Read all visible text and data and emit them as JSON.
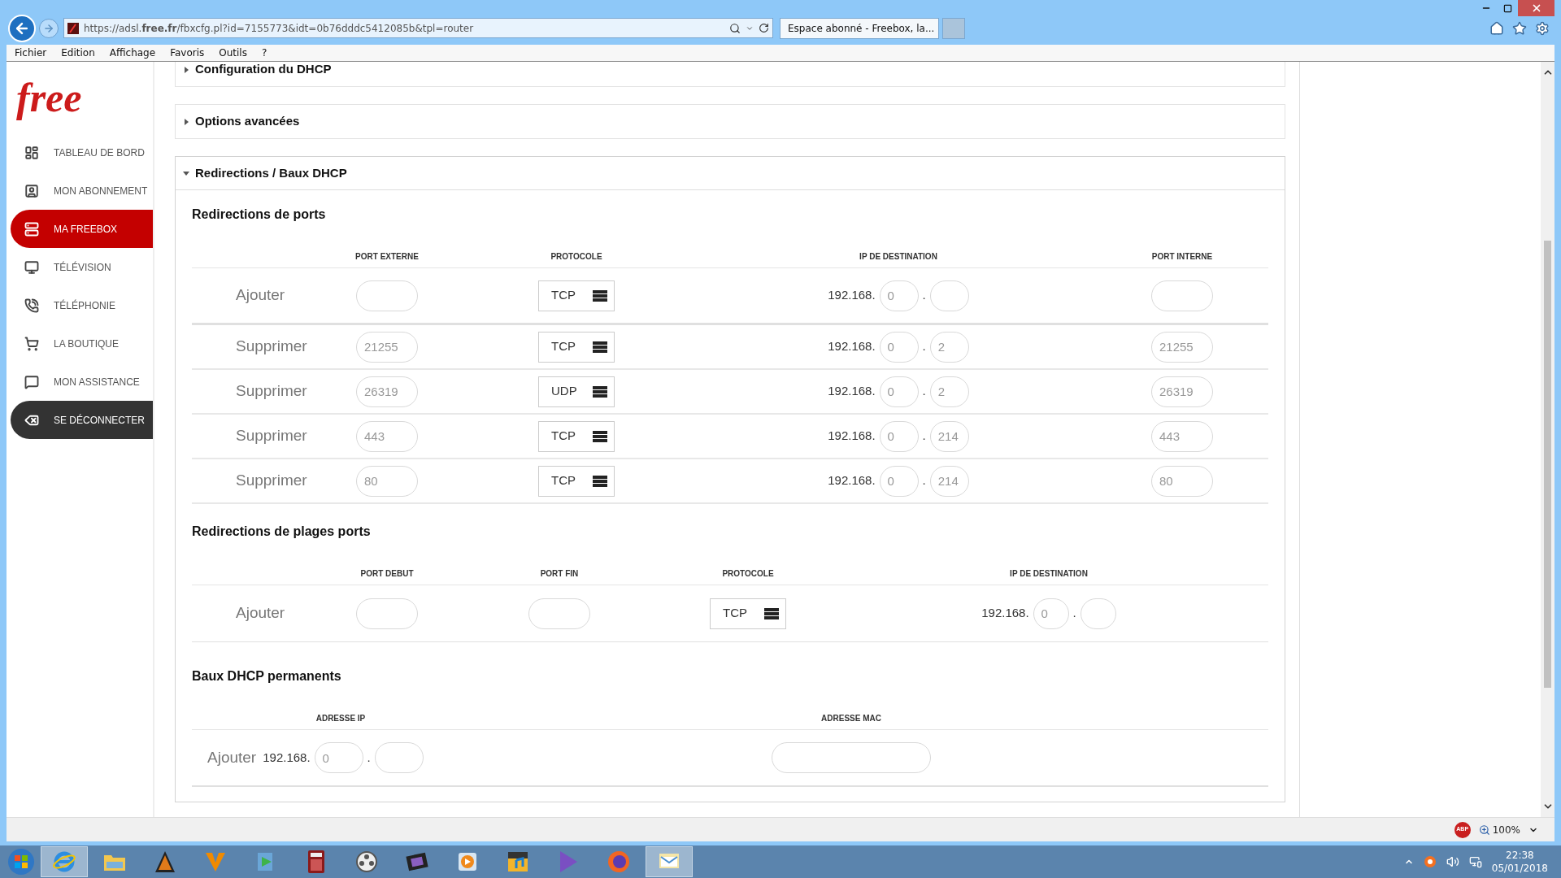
{
  "browser": {
    "url": "https://adsl.**free.fr**/fbxcfg.pl?id=7155773&idt=0b76dddc5412085b&tpl=router",
    "tab_title": "Espace abonné - Freebox, la...",
    "menu": [
      "Fichier",
      "Edition",
      "Affichage",
      "Favoris",
      "Outils",
      "?"
    ]
  },
  "sidebar": {
    "logo": "free",
    "items": [
      {
        "label": "TABLEAU DE BORD",
        "kind": "nav",
        "selected": false
      },
      {
        "label": "MON ABONNEMENT",
        "kind": "nav",
        "selected": false
      },
      {
        "label": "MA FREEBOX",
        "kind": "nav",
        "selected": true
      },
      {
        "label": "TÉLÉVISION",
        "kind": "nav",
        "selected": false
      },
      {
        "label": "TÉLÉPHONIE",
        "kind": "nav",
        "selected": false
      },
      {
        "label": "LA BOUTIQUE",
        "kind": "nav",
        "selected": false
      },
      {
        "label": "MON ASSISTANCE",
        "kind": "nav",
        "selected": false
      },
      {
        "label": "SE DÉCONNECTER",
        "kind": "logout",
        "selected": false
      }
    ]
  },
  "panels": [
    {
      "title": "Configuration du DHCP",
      "expanded": false
    },
    {
      "title": "Options avancées",
      "expanded": false
    },
    {
      "title": "Redirections / Baux DHCP",
      "expanded": true
    }
  ],
  "port_redirects": {
    "title": "Redirections de ports",
    "columns": [
      "PORT EXTERNE",
      "PROTOCOLE",
      "IP DE DESTINATION",
      "PORT INTERNE"
    ],
    "rows": [
      {
        "action": "Ajouter",
        "protocol": "TCP",
        "ip_prefix": "192.168.",
        "ip_3": "0",
        "ip_separator": "."
      },
      {
        "action": "Supprimer",
        "external_port": "21255",
        "protocol": "TCP",
        "ip_prefix": "192.168.",
        "ip_3": "0",
        "ip_separator": ".",
        "ip_4": "2",
        "internal_port": "21255"
      },
      {
        "action": "Supprimer",
        "external_port": "26319",
        "protocol": "UDP",
        "ip_prefix": "192.168.",
        "ip_3": "0",
        "ip_separator": ".",
        "ip_4": "2",
        "internal_port": "26319"
      },
      {
        "action": "Supprimer",
        "external_port": "443",
        "protocol": "TCP",
        "ip_prefix": "192.168.",
        "ip_3": "0",
        "ip_separator": ".",
        "ip_4": "214",
        "internal_port": "443"
      },
      {
        "action": "Supprimer",
        "external_port": "80",
        "protocol": "TCP",
        "ip_prefix": "192.168.",
        "ip_3": "0",
        "ip_separator": ".",
        "ip_4": "214",
        "internal_port": "80"
      }
    ]
  },
  "range_redirects": {
    "title": "Redirections de plages ports",
    "columns": [
      "PORT DEBUT",
      "PORT FIN",
      "PROTOCOLE",
      "IP DE DESTINATION"
    ],
    "rows": [
      {
        "action": "Ajouter",
        "protocol": "TCP",
        "ip_prefix": "192.168.",
        "ip_3": "0",
        "ip_separator": "."
      }
    ]
  },
  "dhcp_leases": {
    "title": "Baux DHCP permanents",
    "columns": [
      "ADRESSE IP",
      "ADRESSE MAC"
    ],
    "rows": [
      {
        "action": "Ajouter",
        "ip_prefix": "192.168.",
        "ip_3": "0",
        "ip_separator": "."
      }
    ]
  },
  "status_bar": {
    "adblock": "ABP",
    "zoom": "100%"
  },
  "taskbar": {
    "time": "22:38",
    "date": "05/01/2018"
  }
}
